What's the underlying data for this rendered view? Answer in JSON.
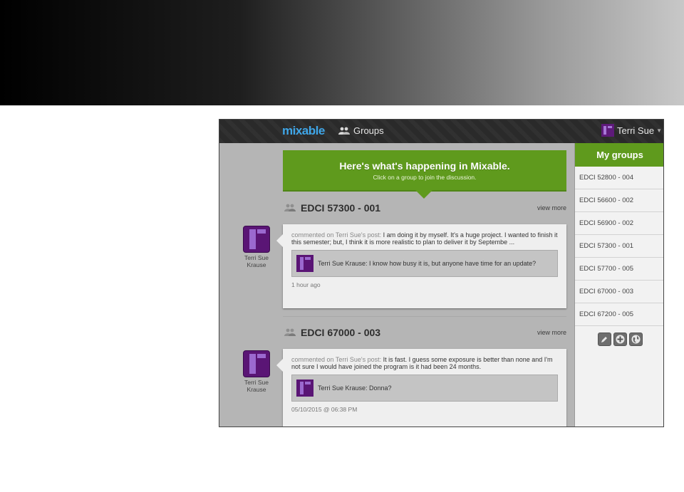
{
  "app": {
    "logo": "mixable",
    "nav_groups_label": "Groups",
    "user_name": "Terri Sue"
  },
  "banner": {
    "title": "Here's what's happening in Mixable.",
    "subtitle": "Click on a group to join the discussion."
  },
  "feed": [
    {
      "group": "EDCI 57300 - 001",
      "view_more": "view more",
      "author_line1": "Terri Sue",
      "author_line2": "Krause",
      "meta": "commented on Terri Sue's post:",
      "text": "I am doing it by myself. It's a huge project. I wanted to finish it this semester; but, I think it is more realistic to plan to deliver it by Septembe ...",
      "reply": "Terri Sue Krause: I know how busy it is, but anyone have time for an update?",
      "time": "1 hour ago"
    },
    {
      "group": "EDCI 67000 - 003",
      "view_more": "view more",
      "author_line1": "Terri Sue",
      "author_line2": "Krause",
      "meta": "commented on Terri Sue's post:",
      "text": "It is fast. I guess some exposure is better than none and I'm not sure I would have joined the program is it had been 24 months.",
      "reply": "Terri Sue Krause: Donna?",
      "time": "05/10/2015 @ 06:38 PM"
    }
  ],
  "sidebar": {
    "title": "My groups",
    "groups": [
      "EDCI 52800 - 004",
      "EDCI 56600 - 002",
      "EDCI 56900 - 002",
      "EDCI 57300 - 001",
      "EDCI 57700 - 005",
      "EDCI 67000 - 003",
      "EDCI 67200 - 005"
    ],
    "tools": [
      "pencil-icon",
      "plus-circle-icon",
      "globe-icon"
    ]
  },
  "colors": {
    "accent_green": "#5f9a1d",
    "logo_blue": "#3fa6e8",
    "avatar_purple": "#5a1575"
  }
}
